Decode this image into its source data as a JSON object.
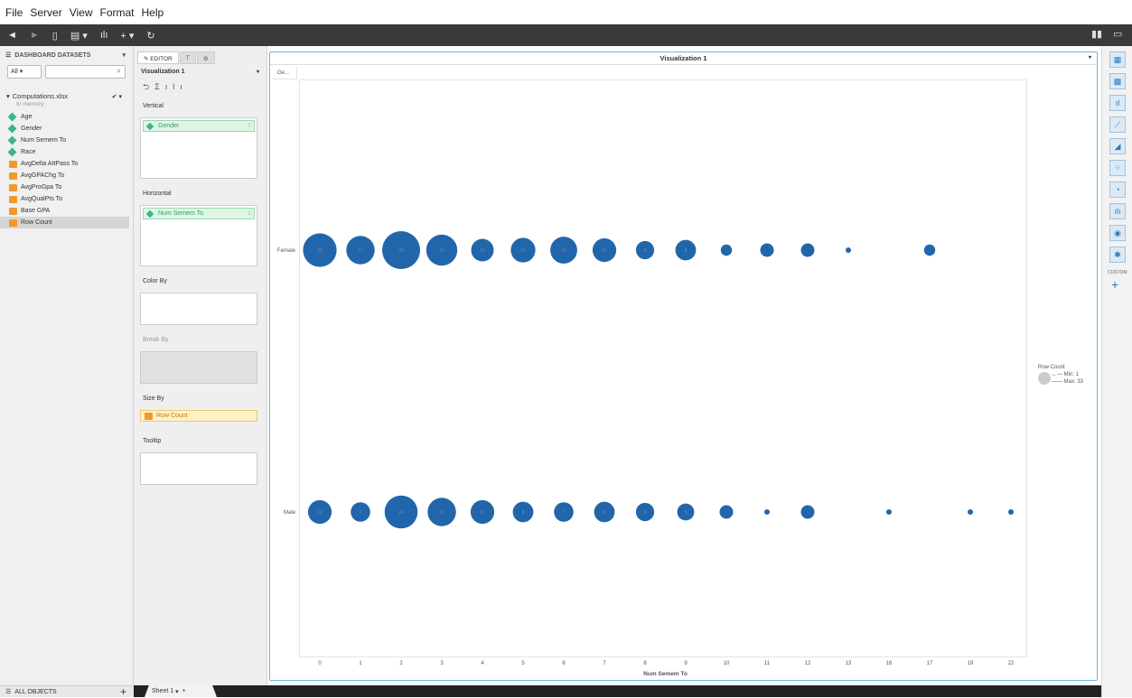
{
  "menu": [
    "File",
    "Server",
    "View",
    "Format",
    "Help"
  ],
  "toolbar": {
    "items": [
      "◄",
      "►",
      "▯",
      "▤ ▾",
      "ılı",
      "+ ▾",
      "↻"
    ],
    "right": [
      "▮▮",
      "▭"
    ]
  },
  "left_panel": {
    "header": "DASHBOARD DATASETS",
    "filter_value": "All",
    "search_placeholder": "",
    "dataset_name": "Computations.xlsx",
    "dataset_status": "In memory",
    "fields": [
      {
        "name": "Age",
        "type": "dimension"
      },
      {
        "name": "Gender",
        "type": "dimension"
      },
      {
        "name": "Num Semem To",
        "type": "dimension"
      },
      {
        "name": "Race",
        "type": "dimension"
      },
      {
        "name": "AvgDelta AttPass To",
        "type": "metric"
      },
      {
        "name": "AvgGPAChg To",
        "type": "metric"
      },
      {
        "name": "AvgProGpa To",
        "type": "metric"
      },
      {
        "name": "AvgQualPts To",
        "type": "metric"
      },
      {
        "name": "Base GPA",
        "type": "metric"
      },
      {
        "name": "Row Count",
        "type": "metric"
      }
    ],
    "footer": "ALL OBJECTS"
  },
  "editor": {
    "tabs": [
      "EDITOR",
      "T",
      "⚙"
    ],
    "viz_name": "Visualization 1",
    "sections": {
      "vertical": {
        "label": "Vertical",
        "pill": "Gender"
      },
      "horizontal": {
        "label": "Horizontal",
        "pill": "Num Semem To"
      },
      "color_by": {
        "label": "Color By"
      },
      "break_by": {
        "label": "Break By"
      },
      "size_by": {
        "label": "Size By",
        "pill": "Row Count"
      },
      "tooltip": {
        "label": "Tooltip"
      }
    }
  },
  "sheet": {
    "tab": "Sheet 1"
  },
  "right_panel": {
    "custom_label": "CUSTOM"
  },
  "visualization": {
    "title": "Visualization 1",
    "column_header": "Ge...",
    "legend": {
      "title": "Row Count",
      "min": "Min: 1",
      "max": "Max: 33"
    }
  },
  "chart_data": {
    "type": "scatter",
    "xlabel": "Num Semem To",
    "x_categories": [
      "0",
      "1",
      "2",
      "3",
      "4",
      "5",
      "6",
      "7",
      "8",
      "9",
      "10",
      "11",
      "12",
      "13",
      "16",
      "17",
      "19",
      "22"
    ],
    "y_categories": [
      "Female",
      "Male"
    ],
    "size_by": "Row Count",
    "size_range": [
      1,
      33
    ],
    "bubble_color": "#2166ab",
    "series": [
      {
        "name": "Female",
        "points": [
          {
            "x": "0",
            "size": 25,
            "label": "25"
          },
          {
            "x": "1",
            "size": 17,
            "label": "17"
          },
          {
            "x": "2",
            "size": 33,
            "label": "33"
          },
          {
            "x": "3",
            "size": 21,
            "label": "21"
          },
          {
            "x": "4",
            "size": 10,
            "label": "10"
          },
          {
            "x": "5",
            "size": 12,
            "label": "12"
          },
          {
            "x": "6",
            "size": 15,
            "label": "15"
          },
          {
            "x": "7",
            "size": 11,
            "label": "11"
          },
          {
            "x": "8",
            "size": 6,
            "label": "6"
          },
          {
            "x": "9",
            "size": 8,
            "label": "8"
          },
          {
            "x": "10",
            "size": 2
          },
          {
            "x": "11",
            "size": 3
          },
          {
            "x": "12",
            "size": 3
          },
          {
            "x": "13",
            "size": 1
          },
          {
            "x": "17",
            "size": 2
          }
        ]
      },
      {
        "name": "Male",
        "points": [
          {
            "x": "0",
            "size": 11,
            "label": "11"
          },
          {
            "x": "1",
            "size": 7,
            "label": "7"
          },
          {
            "x": "2",
            "size": 24,
            "label": "24"
          },
          {
            "x": "3",
            "size": 17,
            "label": "17"
          },
          {
            "x": "4",
            "size": 11,
            "label": "11"
          },
          {
            "x": "5",
            "size": 8,
            "label": "8"
          },
          {
            "x": "6",
            "size": 7,
            "label": "7"
          },
          {
            "x": "7",
            "size": 8,
            "label": "8"
          },
          {
            "x": "8",
            "size": 6,
            "label": "6"
          },
          {
            "x": "9",
            "size": 5,
            "label": "5"
          },
          {
            "x": "10",
            "size": 3
          },
          {
            "x": "11",
            "size": 1
          },
          {
            "x": "12",
            "size": 3
          },
          {
            "x": "16",
            "size": 1
          },
          {
            "x": "19",
            "size": 1
          },
          {
            "x": "22",
            "size": 1
          }
        ]
      }
    ]
  }
}
